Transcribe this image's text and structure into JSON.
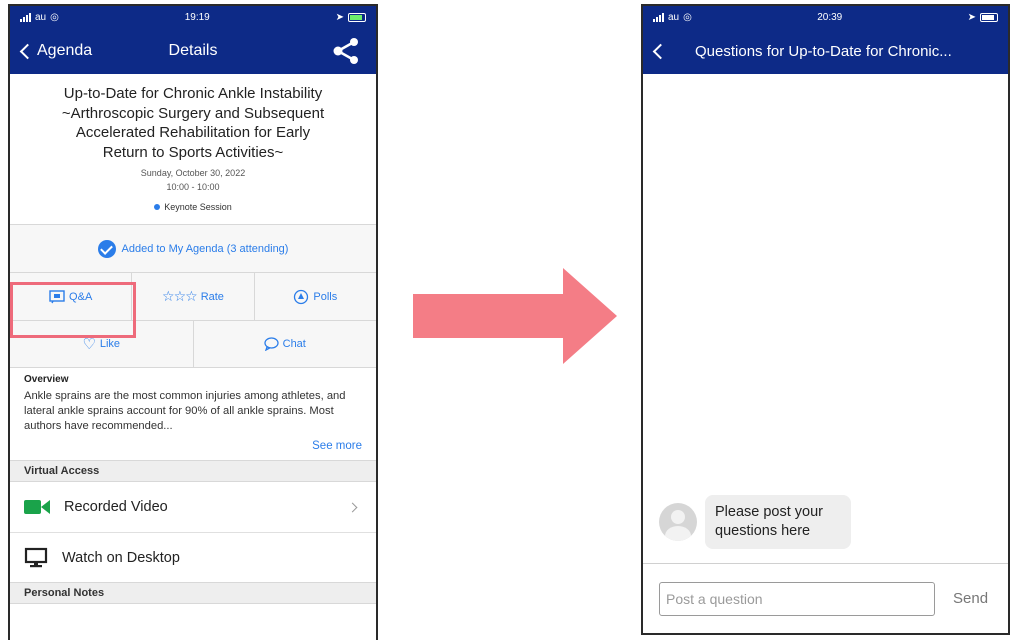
{
  "left": {
    "status": {
      "carrier": "au",
      "time": "19:19"
    },
    "nav": {
      "back_label": "Agenda",
      "title": "Details"
    },
    "session": {
      "title": "Up-to-Date for Chronic Ankle Instability ~Arthroscopic Surgery and Subsequent Accelerated Rehabilitation for Early Return to Sports Activities~",
      "date": "Sunday, October 30, 2022",
      "time": "10:00 - 10:00",
      "type": "Keynote Session"
    },
    "agenda_status": "Added to My Agenda (3 attending)",
    "actions": {
      "qa": "Q&A",
      "rate": "Rate",
      "polls": "Polls"
    },
    "social": {
      "like": "Like",
      "chat": "Chat"
    },
    "overview": {
      "heading": "Overview",
      "text": "Ankle sprains are the most common injuries among athletes, and lateral ankle sprains account for 90% of all ankle sprains. Most authors have recommended...",
      "see_more": "See more"
    },
    "virtual_access": {
      "heading": "Virtual Access",
      "items": [
        "Recorded Video",
        "Watch on Desktop"
      ]
    },
    "personal_notes": "Personal Notes"
  },
  "right": {
    "status": {
      "carrier": "au",
      "time": "20:39"
    },
    "nav": {
      "title": "Questions for Up-to-Date for Chronic..."
    },
    "message": "Please post your questions here",
    "composer": {
      "placeholder": "Post a question",
      "send_label": "Send"
    }
  },
  "colors": {
    "nav_bg": "#0d2a87",
    "accent": "#2b7de9",
    "highlight": "#ee6b7b",
    "video_green": "#1aa34a"
  }
}
